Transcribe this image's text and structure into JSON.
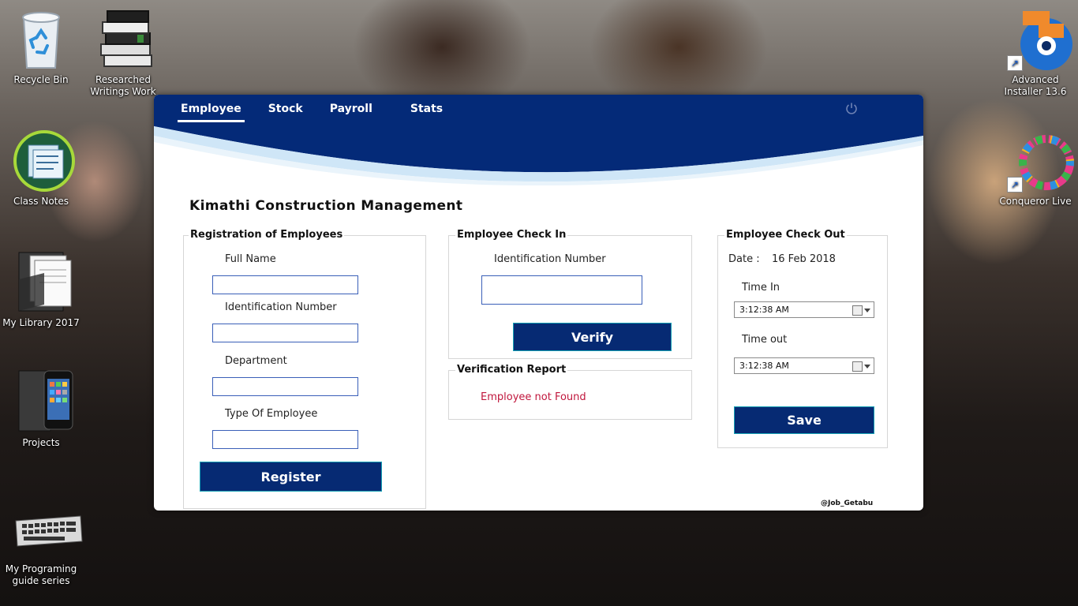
{
  "desktop": {
    "icons": [
      {
        "name": "Recycle Bin",
        "icon": "recycle-bin-icon"
      },
      {
        "name": "Researched Writings Work",
        "icon": "books-icon"
      },
      {
        "name": "Class Notes",
        "icon": "class-notes-icon"
      },
      {
        "name": "My Library 2017",
        "icon": "folder-icon"
      },
      {
        "name": "Projects",
        "icon": "phone-folder-icon"
      },
      {
        "name": "My Programing guide series",
        "icon": "keyboard-icon"
      },
      {
        "name": "Advanced Installer 13.6",
        "icon": "advanced-installer-icon"
      },
      {
        "name": "Conqueror Live",
        "icon": "conqueror-icon"
      }
    ]
  },
  "app": {
    "nav": {
      "tabs": [
        "Employee",
        "Stock",
        "Payroll",
        "Stats"
      ],
      "active": "Employee"
    },
    "title": "Kimathi Construction Management",
    "registration": {
      "legend": "Registration of Employees",
      "full_name_label": "Full Name",
      "full_name_value": "",
      "id_label": "Identification Number",
      "id_value": "",
      "department_label": "Department",
      "department_value": "",
      "type_label": "Type Of Employee",
      "type_value": "",
      "register_button": "Register"
    },
    "check_in": {
      "legend": "Employee Check In",
      "id_label": "Identification Number",
      "id_value": "",
      "verify_button": "Verify"
    },
    "verification_report": {
      "legend": "Verification Report",
      "message": "Employee not Found"
    },
    "check_out": {
      "legend": "Employee Check Out",
      "date_label": "Date :",
      "date_value": "16 Feb 2018",
      "time_in_label": "Time In",
      "time_in_value": "3:12:38 AM",
      "time_out_label": "Time out",
      "time_out_value": "3:12:38 AM",
      "save_button": "Save"
    },
    "watermark": "@Job_Getabu",
    "colors": {
      "header": "#042a78",
      "button": "#062a73",
      "error_text": "#c0163c"
    }
  }
}
